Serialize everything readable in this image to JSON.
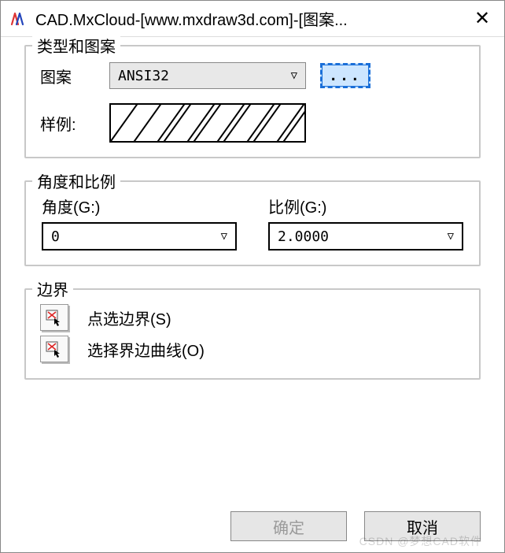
{
  "window": {
    "title": "CAD.MxCloud-[www.mxdraw3d.com]-[图案..."
  },
  "group1": {
    "title": "类型和图案",
    "pattern_label": "图案",
    "pattern_value": "ANSI32",
    "browse_btn": "...",
    "sample_label": "样例:"
  },
  "group2": {
    "title": "角度和比例",
    "angle_label": "角度(G:)",
    "angle_value": "0",
    "scale_label": "比例(G:)",
    "scale_value": "2.0000"
  },
  "group3": {
    "title": "边界",
    "pick_label": "点选边界(S)",
    "select_label": "选择界边曲线(O)"
  },
  "footer": {
    "ok": "确定",
    "cancel": "取消"
  },
  "watermark": "CSDN @梦想CAD软件"
}
